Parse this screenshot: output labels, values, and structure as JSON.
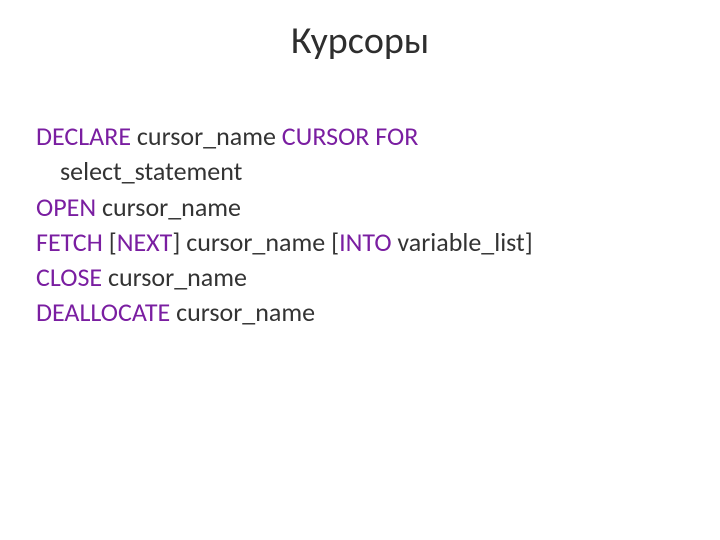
{
  "title": "Курсоры",
  "code": {
    "declare_kw": "DECLARE",
    "declare_arg": " cursor_name ",
    "cursor_for_kw": "CURSOR FOR",
    "select_stmt": "select_statement",
    "open_kw": "OPEN",
    "open_arg": " cursor_name",
    "fetch_kw": "FETCH",
    "fetch_lb": " [",
    "next_kw": "NEXT",
    "fetch_mid": "] cursor_name [",
    "into_kw": "INTO",
    "fetch_tail": " variable_list]",
    "close_kw": "CLOSE",
    "close_arg": " cursor_name",
    "dealloc_kw": "DEALLOCATE",
    "dealloc_arg": " cursor_name"
  }
}
